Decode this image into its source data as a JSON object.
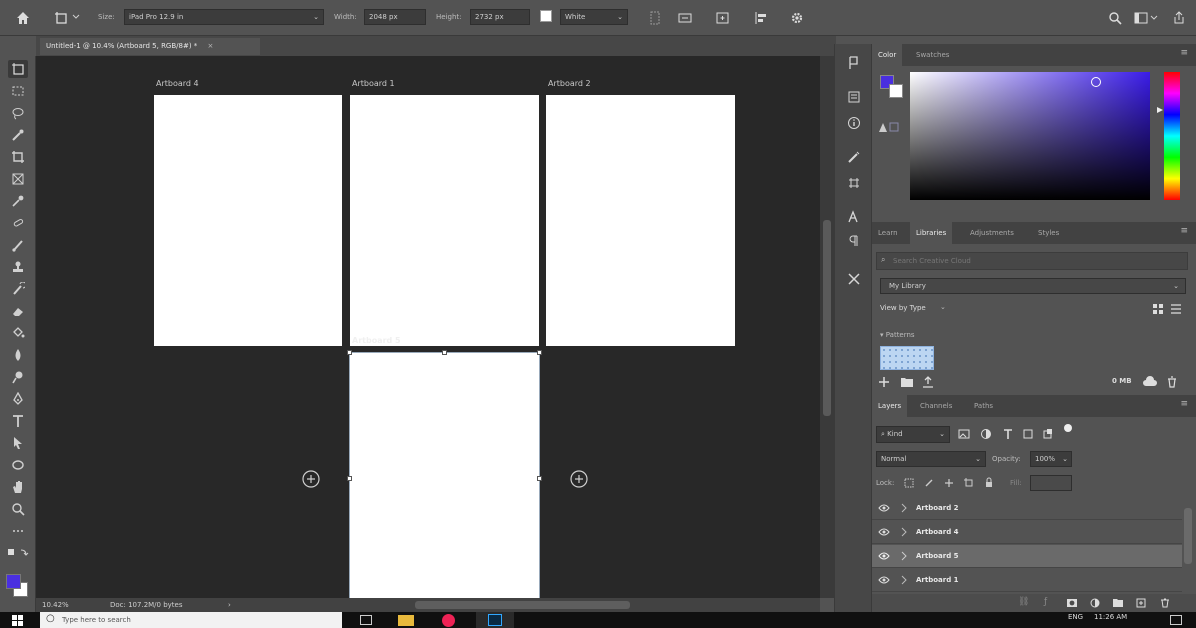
{
  "options_bar": {
    "size_label": "Size:",
    "size_value": "iPad Pro 12.9 in",
    "width_label": "Width:",
    "width_value": "2048 px",
    "height_label": "Height:",
    "height_value": "2732 px",
    "bg_value": "White"
  },
  "document": {
    "tab_title": "Untitled-1 @ 10.4% (Artboard 5, RGB/8#) *"
  },
  "artboards": [
    {
      "label": "Artboard 4"
    },
    {
      "label": "Artboard 1"
    },
    {
      "label": "Artboard 2"
    },
    {
      "label": "Artboard 5"
    }
  ],
  "status": {
    "zoom": "10.42%",
    "doc_info": "Doc: 107.2M/0 bytes"
  },
  "panels": {
    "color_tabs": [
      "Color",
      "Swatches"
    ],
    "libraries_tabs": [
      "Learn",
      "Libraries",
      "Adjustments",
      "Styles"
    ],
    "library_search_placeholder": "Search Creative Cloud",
    "library_name": "My Library",
    "view_by": "View by Type",
    "patterns_label": "Patterns",
    "library_size": "0 MB",
    "layers_tabs": [
      "Layers",
      "Channels",
      "Paths"
    ],
    "kind_filter": "Kind",
    "blend_mode": "Normal",
    "opacity_label": "Opacity:",
    "opacity_value": "100%",
    "lock_label": "Lock:",
    "fill_label": "Fill:"
  },
  "layers": [
    {
      "name": "Artboard 2",
      "selected": false
    },
    {
      "name": "Artboard 4",
      "selected": false
    },
    {
      "name": "Artboard 5",
      "selected": true
    },
    {
      "name": "Artboard 1",
      "selected": false
    }
  ],
  "taskbar": {
    "search_placeholder": "Type here to search",
    "lang": "ENG",
    "time": "11:26 AM"
  },
  "colors": {
    "foreground": "#4a2fe0",
    "background": "#ffffff",
    "picker_hue": "#3a1ce8",
    "canvas": "#282828",
    "panel": "#535353"
  }
}
